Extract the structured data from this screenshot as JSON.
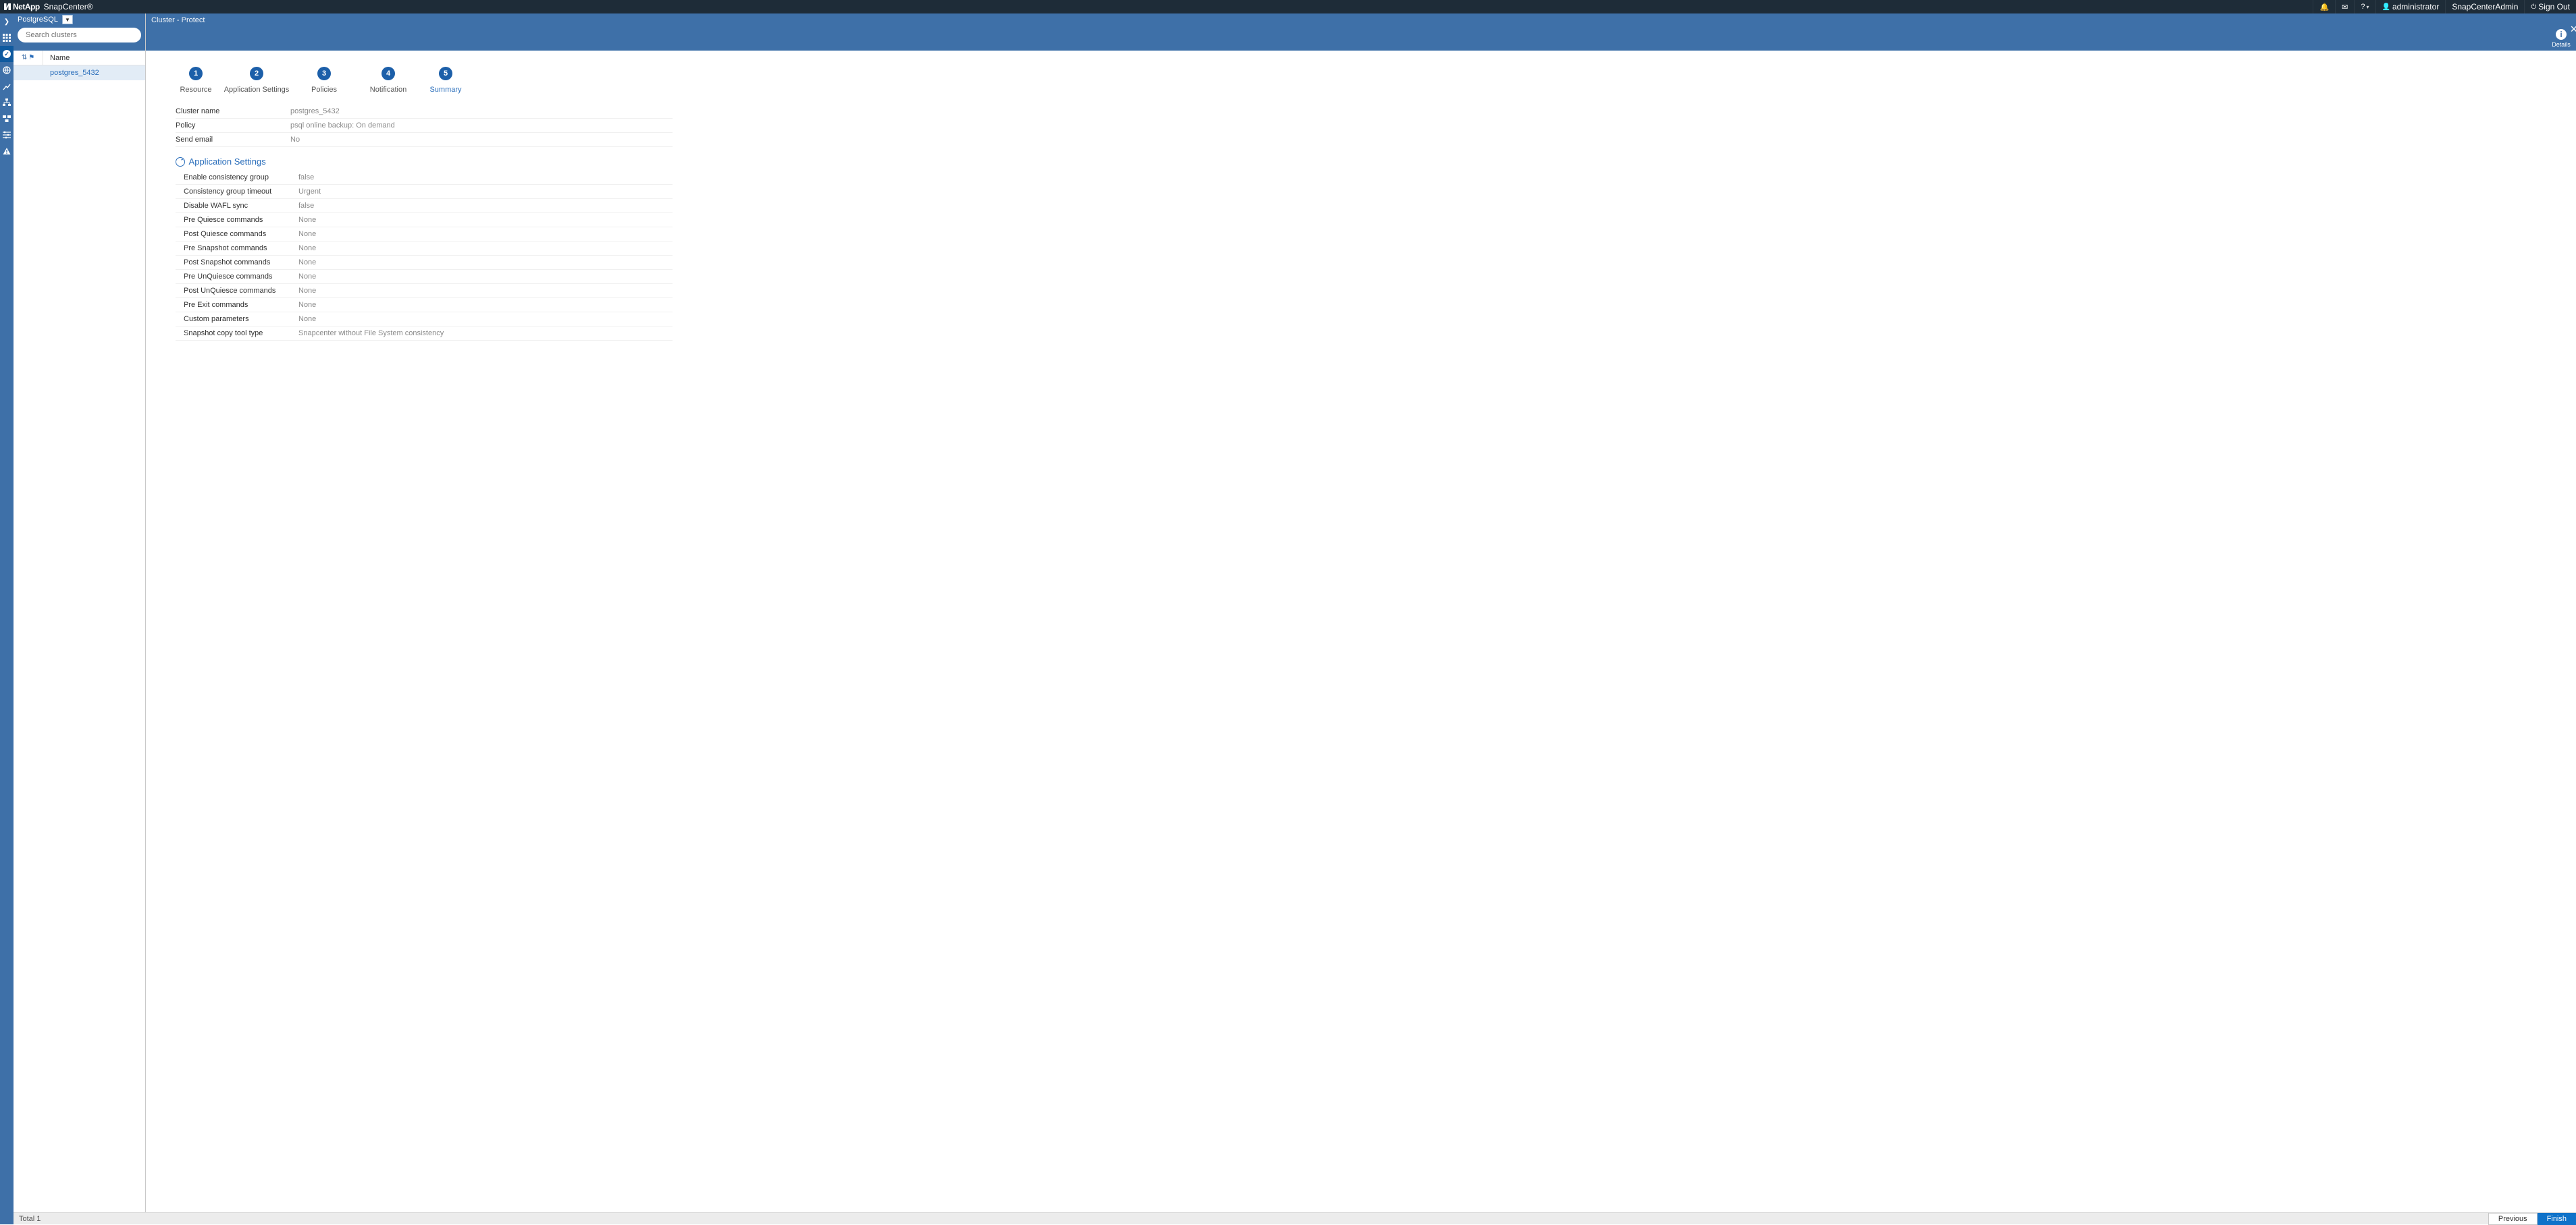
{
  "header": {
    "brand1": "NetApp",
    "brand2": "SnapCenter®",
    "help": "?",
    "user": "administrator",
    "role": "SnapCenterAdmin",
    "signout": "Sign Out"
  },
  "rescol": {
    "type_label": "PostgreSQL",
    "search_placeholder": "Search clusters",
    "col_name": "Name",
    "rows": [
      {
        "name": "postgres_5432"
      }
    ],
    "total_label": "Total 1"
  },
  "subhdr": {
    "crumb": "Cluster - Protect",
    "details": "Details"
  },
  "wizard": {
    "steps": [
      {
        "n": "1",
        "label": "Resource"
      },
      {
        "n": "2",
        "label": "Application Settings"
      },
      {
        "n": "3",
        "label": "Policies"
      },
      {
        "n": "4",
        "label": "Notification"
      },
      {
        "n": "5",
        "label": "Summary"
      }
    ],
    "active_step": 5
  },
  "summary": {
    "top": [
      {
        "k": "Cluster name",
        "v": "postgres_5432"
      },
      {
        "k": "Policy",
        "v": "psql online backup: On demand"
      },
      {
        "k": "Send email",
        "v": "No"
      }
    ],
    "section_title": "Application Settings",
    "app": [
      {
        "k": "Enable consistency group",
        "v": "false"
      },
      {
        "k": "Consistency group timeout",
        "v": "Urgent"
      },
      {
        "k": "Disable WAFL sync",
        "v": "false"
      },
      {
        "k": "Pre Quiesce commands",
        "v": "None"
      },
      {
        "k": "Post Quiesce commands",
        "v": "None"
      },
      {
        "k": "Pre Snapshot commands",
        "v": "None"
      },
      {
        "k": "Post Snapshot commands",
        "v": "None"
      },
      {
        "k": "Pre UnQuiesce commands",
        "v": "None"
      },
      {
        "k": "Post UnQuiesce commands",
        "v": "None"
      },
      {
        "k": "Pre Exit commands",
        "v": "None"
      },
      {
        "k": "Custom parameters",
        "v": "None"
      },
      {
        "k": "Snapshot copy tool type",
        "v": "Snapcenter without File System consistency"
      }
    ]
  },
  "footer": {
    "previous": "Previous",
    "finish": "Finish"
  }
}
